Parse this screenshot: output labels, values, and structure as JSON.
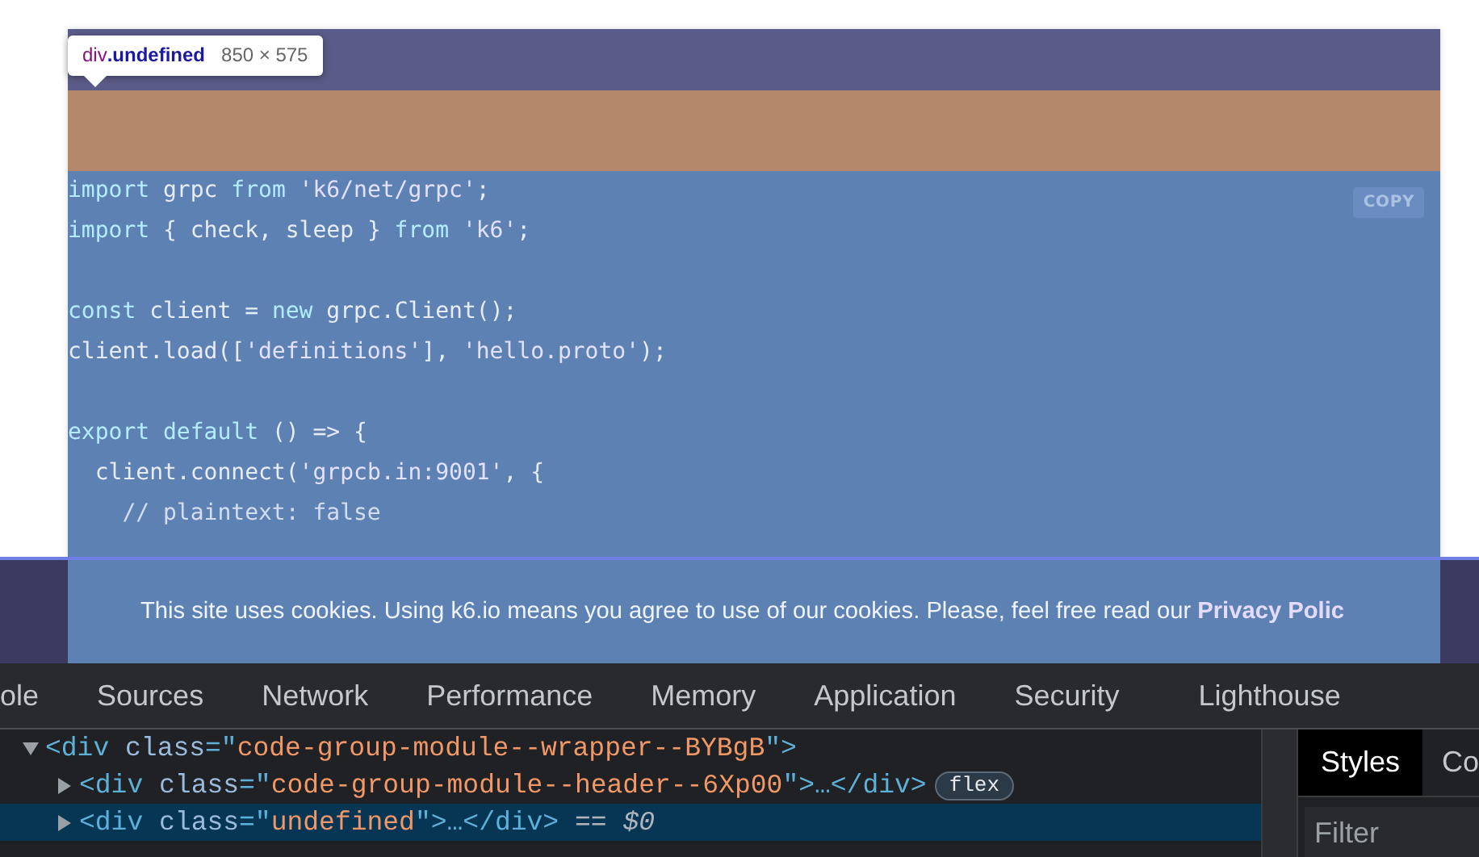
{
  "inspect_tooltip": {
    "selector": "div.undefined",
    "size": "850 × 575"
  },
  "code_block": {
    "copy_button": "COPY",
    "groups": [
      [
        [
          {
            "text": "import",
            "kind": "keyword"
          },
          {
            "text": " grpc ",
            "kind": "plain"
          },
          {
            "text": "from",
            "kind": "keyword"
          },
          {
            "text": " 'k6/net/grpc'",
            "kind": "string"
          },
          {
            "text": ";",
            "kind": "punct"
          }
        ],
        [
          {
            "text": "import",
            "kind": "keyword"
          },
          {
            "text": " { check, sleep } ",
            "kind": "plain"
          },
          {
            "text": "from",
            "kind": "keyword"
          },
          {
            "text": " 'k6'",
            "kind": "string"
          },
          {
            "text": ";",
            "kind": "punct"
          }
        ]
      ],
      [
        [
          {
            "text": "const",
            "kind": "keyword"
          },
          {
            "text": " client = ",
            "kind": "plain"
          },
          {
            "text": "new",
            "kind": "keyword"
          },
          {
            "text": " grpc.Client();",
            "kind": "plain"
          }
        ],
        [
          {
            "text": "client.load([",
            "kind": "plain"
          },
          {
            "text": "'definitions'",
            "kind": "string"
          },
          {
            "text": "], ",
            "kind": "plain"
          },
          {
            "text": "'hello.proto'",
            "kind": "string"
          },
          {
            "text": ");",
            "kind": "plain"
          }
        ]
      ],
      [
        [
          {
            "text": "export",
            "kind": "keyword"
          },
          {
            "text": " default",
            "kind": "keyword"
          },
          {
            "text": " () => {",
            "kind": "plain"
          }
        ],
        [
          {
            "text": "  client.connect(",
            "kind": "plain"
          },
          {
            "text": "'grpcb.in:9001'",
            "kind": "string"
          },
          {
            "text": ", {",
            "kind": "plain"
          }
        ],
        [
          {
            "text": "    // plaintext: false",
            "kind": "comment"
          }
        ]
      ]
    ]
  },
  "cookie_banner": {
    "text": "This site uses cookies. Using k6.io means you agree to use of our cookies. Please, feel free read our ",
    "link": "Privacy Polic"
  },
  "devtools": {
    "tabs": [
      "ole",
      "Sources",
      "Network",
      "Performance",
      "Memory",
      "Application",
      "Security",
      "Lighthouse"
    ],
    "dom_tree": [
      {
        "expanded": true,
        "selected": false,
        "tokens": [
          {
            "text": "<div ",
            "kind": "tag"
          },
          {
            "text": "class",
            "kind": "attr"
          },
          {
            "text": "=\"",
            "kind": "tag"
          },
          {
            "text": "code-group-module--wrapper--BYBgB",
            "kind": "value"
          },
          {
            "text": "\">",
            "kind": "tag"
          }
        ],
        "children": [
          {
            "expanded": false,
            "selected": false,
            "tokens": [
              {
                "text": "<div ",
                "kind": "tag"
              },
              {
                "text": "class",
                "kind": "attr"
              },
              {
                "text": "=\"",
                "kind": "tag"
              },
              {
                "text": "code-group-module--header--6Xp00",
                "kind": "value"
              },
              {
                "text": "\">…</div>",
                "kind": "tag"
              }
            ],
            "badge": "flex"
          },
          {
            "expanded": false,
            "selected": true,
            "tokens": [
              {
                "text": "<div ",
                "kind": "tag"
              },
              {
                "text": "class",
                "kind": "attr"
              },
              {
                "text": "=\"",
                "kind": "tag"
              },
              {
                "text": "undefined",
                "kind": "value"
              },
              {
                "text": "\">…</div>",
                "kind": "tag"
              },
              {
                "text": " == $0",
                "kind": "note"
              }
            ]
          }
        ]
      }
    ],
    "side_tabs": [
      {
        "label": "Styles",
        "selected": true
      },
      {
        "label": "Co",
        "selected": false
      }
    ],
    "filter": {
      "placeholder": "Filter"
    }
  }
}
